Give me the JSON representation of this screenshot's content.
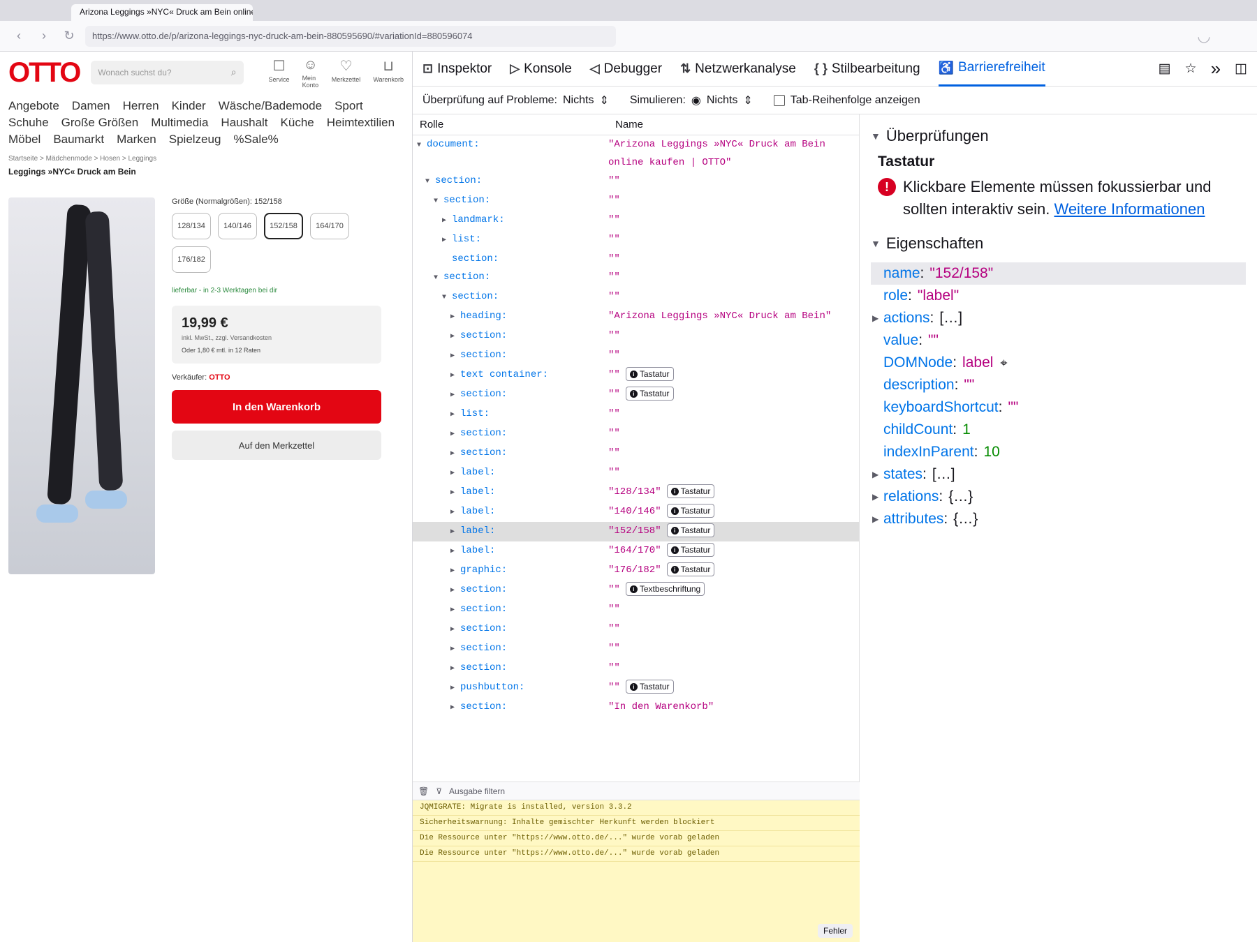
{
  "browser": {
    "tabs": [
      "",
      "Arizona Leggings »NYC« Druck am Bein online kaufen | OTTO"
    ],
    "url": "https://www.otto.de/p/arizona-leggings-nyc-druck-am-bein-880595690/#variationId=880596074"
  },
  "otto": {
    "logo": "OTTO",
    "search_placeholder": "Wonach suchst du?",
    "header_icons": [
      {
        "label": "Service",
        "icon": "service-icon"
      },
      {
        "label": "Mein Konto",
        "icon": "account-icon"
      },
      {
        "label": "Merkzettel",
        "icon": "heart-icon"
      },
      {
        "label": "Warenkorb",
        "icon": "cart-icon"
      }
    ],
    "nav": [
      "Angebote",
      "Damen",
      "Herren",
      "Kinder",
      "Wäsche/Bademode",
      "Sport",
      "Schuhe",
      "Große Größen",
      "Multimedia",
      "Haushalt",
      "Küche",
      "Heimtextilien",
      "Möbel",
      "Baumarkt",
      "Marken",
      "Spielzeug",
      "%Sale%"
    ],
    "breadcrumb": "Startseite > Mädchenmode > Hosen > Leggings",
    "product_title": "Leggings »NYC« Druck am Bein",
    "size_label": "Größe (Normalgrößen): 152/158",
    "sizes": [
      "128/134",
      "140/146",
      "152/158",
      "164/170",
      "176/182"
    ],
    "selected_size": "152/158",
    "delivery": "lieferbar - in 2-3 Werktagen bei dir",
    "price": "19,99 €",
    "price_note": "inkl. MwSt., zzgl. Versandkosten",
    "price_small": "Oder 1,80 € mtl. in 12 Raten",
    "seller_prefix": "Verkäufer:",
    "seller": "OTTO",
    "cart_button": "In den Warenkorb",
    "wish_button": "Auf den Merkzettel"
  },
  "devtools": {
    "tabs": [
      {
        "label": "Inspektor",
        "icon": "inspector-icon",
        "glyph": "⊡"
      },
      {
        "label": "Konsole",
        "icon": "console-icon",
        "glyph": "▷"
      },
      {
        "label": "Debugger",
        "icon": "debugger-icon",
        "glyph": "◁"
      },
      {
        "label": "Netzwerkanalyse",
        "icon": "network-icon",
        "glyph": "⇅"
      },
      {
        "label": "Stilbearbeitung",
        "icon": "style-editor-icon",
        "glyph": "{ }"
      },
      {
        "label": "Barrierefreiheit",
        "icon": "accessibility-icon",
        "glyph": "♿",
        "active": true
      }
    ],
    "toolbar": {
      "check_label": "Überprüfung auf Probleme:",
      "check_value": "Nichts",
      "simulate_label": "Simulieren:",
      "simulate_value": "Nichts",
      "tab_order_label": "Tab-Reihenfolge anzeigen"
    },
    "tree": {
      "col_role": "Rolle",
      "col_name": "Name",
      "rows": [
        {
          "depth": 0,
          "role": "document:",
          "name": "\"Arizona Leggings »NYC« Druck am Bein online kaufen | OTTO\"",
          "expanded": true
        },
        {
          "depth": 1,
          "role": "section:",
          "name": "\"\"",
          "expanded": true
        },
        {
          "depth": 2,
          "role": "section:",
          "name": "\"\"",
          "expanded": true
        },
        {
          "depth": 3,
          "role": "landmark:",
          "name": "\"\"",
          "expanded": false
        },
        {
          "depth": 3,
          "role": "list:",
          "name": "\"\"",
          "expanded": false
        },
        {
          "depth": 3,
          "role": "section:",
          "name": "\"\"",
          "leaf": true
        },
        {
          "depth": 2,
          "role": "section:",
          "name": "\"\"",
          "expanded": true
        },
        {
          "depth": 3,
          "role": "section:",
          "name": "\"\"",
          "expanded": true
        },
        {
          "depth": 4,
          "role": "heading:",
          "name": "\"Arizona Leggings »NYC« Druck am Bein\"",
          "expanded": false
        },
        {
          "depth": 4,
          "role": "section:",
          "name": "\"\"",
          "expanded": false
        },
        {
          "depth": 4,
          "role": "section:",
          "name": "\"\"",
          "expanded": false
        },
        {
          "depth": 4,
          "role": "text container:",
          "name": "\"\"",
          "badge": "Tastatur",
          "expanded": false
        },
        {
          "depth": 4,
          "role": "section:",
          "name": "\"\"",
          "badge": "Tastatur",
          "expanded": false
        },
        {
          "depth": 4,
          "role": "list:",
          "name": "\"\"",
          "expanded": false
        },
        {
          "depth": 4,
          "role": "section:",
          "name": "\"\"",
          "expanded": false
        },
        {
          "depth": 4,
          "role": "section:",
          "name": "\"\"",
          "expanded": false
        },
        {
          "depth": 4,
          "role": "label:",
          "name": "\"\"",
          "expanded": false
        },
        {
          "depth": 4,
          "role": "label:",
          "name": "\"128/134\"",
          "badge": "Tastatur",
          "expanded": false
        },
        {
          "depth": 4,
          "role": "label:",
          "name": "\"140/146\"",
          "badge": "Tastatur",
          "expanded": false
        },
        {
          "depth": 4,
          "role": "label:",
          "name": "\"152/158\"",
          "badge": "Tastatur",
          "expanded": false,
          "selected": true
        },
        {
          "depth": 4,
          "role": "label:",
          "name": "\"164/170\"",
          "badge": "Tastatur",
          "expanded": false
        },
        {
          "depth": 4,
          "role": "graphic:",
          "name": "\"176/182\"",
          "badge": "Tastatur",
          "expanded": false
        },
        {
          "depth": 4,
          "role": "section:",
          "name": "\"\"",
          "badge": "Textbeschriftung",
          "expanded": false
        },
        {
          "depth": 4,
          "role": "section:",
          "name": "\"\"",
          "expanded": false
        },
        {
          "depth": 4,
          "role": "section:",
          "name": "\"\"",
          "expanded": false
        },
        {
          "depth": 4,
          "role": "section:",
          "name": "\"\"",
          "expanded": false
        },
        {
          "depth": 4,
          "role": "section:",
          "name": "\"\"",
          "expanded": false
        },
        {
          "depth": 4,
          "role": "pushbutton:",
          "name": "\"\"",
          "badge": "Tastatur",
          "expanded": false
        },
        {
          "depth": 4,
          "role": "section:",
          "name": "\"In den Warenkorb\"",
          "expanded": false
        }
      ]
    },
    "console": {
      "filter_placeholder": "Ausgabe filtern",
      "messages": [
        "JQMIGRATE: Migrate is installed, version 3.3.2",
        "Sicherheitswarnung: Inhalte gemischter Herkunft werden blockiert",
        "Die Ressource unter \"https://www.otto.de/...\" wurde vorab geladen",
        "Die Ressource unter \"https://www.otto.de/...\" wurde vorab geladen"
      ],
      "error_button": "Fehler"
    },
    "sidebar": {
      "checks_header": "Überprüfungen",
      "keyboard_title": "Tastatur",
      "warning_text": "Klickbare Elemente müssen fokussierbar und sollten interaktiv sein.",
      "link_text": "Weitere Informationen",
      "props_header": "Eigenschaften",
      "props": [
        {
          "key": "name",
          "value": "\"152/158\"",
          "type": "str",
          "hl": true
        },
        {
          "key": "role",
          "value": "\"label\"",
          "type": "str"
        },
        {
          "key": "actions",
          "value": "[…]",
          "type": "obj",
          "twisty": true
        },
        {
          "key": "value",
          "value": "\"\"",
          "type": "str"
        },
        {
          "key": "DOMNode",
          "value": "label",
          "type": "str",
          "target": true
        },
        {
          "key": "description",
          "value": "\"\"",
          "type": "str"
        },
        {
          "key": "keyboardShortcut",
          "value": "\"\"",
          "type": "str"
        },
        {
          "key": "childCount",
          "value": "1",
          "type": "num"
        },
        {
          "key": "indexInParent",
          "value": "10",
          "type": "num"
        },
        {
          "key": "states",
          "value": "[…]",
          "type": "obj",
          "twisty": true
        },
        {
          "key": "relations",
          "value": "{…}",
          "type": "obj",
          "twisty": true
        },
        {
          "key": "attributes",
          "value": "{…}",
          "type": "obj",
          "twisty": true
        }
      ]
    }
  }
}
